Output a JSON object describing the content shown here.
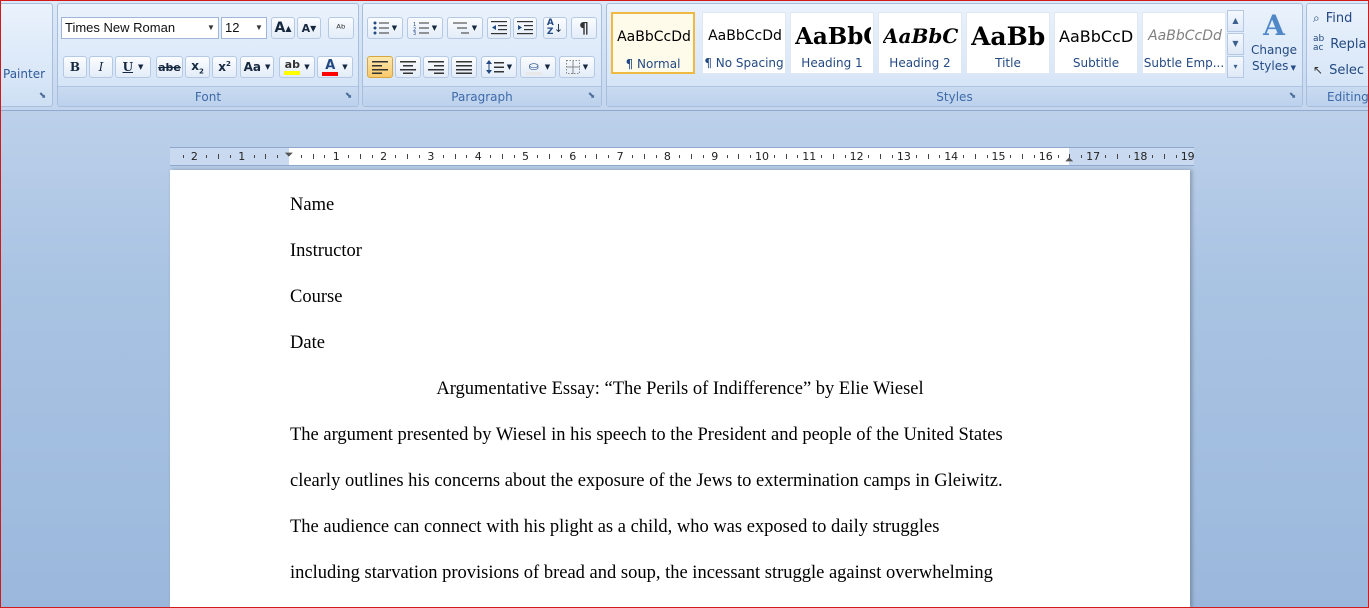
{
  "clipboard": {
    "format_painter_label": "Painter"
  },
  "font_group": {
    "label": "Font",
    "font_name": "Times New Roman",
    "font_size": "12",
    "grow_font": "A",
    "shrink_font": "A",
    "bold": "B",
    "italic": "I",
    "underline": "U",
    "strikethrough": "abe",
    "subscript": "x",
    "superscript": "x",
    "change_case": "Aa",
    "highlight_color": "#ffff00",
    "font_color": "#ff0000"
  },
  "paragraph_group": {
    "label": "Paragraph",
    "show_marks": "¶"
  },
  "styles_group": {
    "label": "Styles",
    "items": [
      {
        "sample": "AaBbCcDd",
        "name": "¶ Normal",
        "selected": true
      },
      {
        "sample": "AaBbCcDd",
        "name": "¶ No Spacing"
      },
      {
        "sample": "AaBbC(",
        "name": "Heading 1"
      },
      {
        "sample": "AaBbCc",
        "name": "Heading 2"
      },
      {
        "sample": "AaBb(",
        "name": "Title"
      },
      {
        "sample": "AaBbCcD",
        "name": "Subtitle"
      },
      {
        "sample": "AaBbCcDd",
        "name": "Subtle Emp..."
      }
    ],
    "change_styles": [
      "Change",
      "Styles"
    ]
  },
  "editing_group": {
    "label": "Editing",
    "find": "Find",
    "replace": "Repla",
    "select": "Selec"
  },
  "ruler": {
    "left_numbers": [
      "2",
      "1"
    ],
    "right_numbers": [
      "1",
      "2",
      "3",
      "4",
      "5",
      "6",
      "7",
      "8",
      "9",
      "10",
      "11",
      "12",
      "13",
      "14",
      "15",
      "16",
      "17",
      "18",
      "19"
    ]
  },
  "document": {
    "header_lines": [
      "Name",
      "Instructor",
      "Course",
      "Date"
    ],
    "title": "Argumentative Essay: “The Perils of Indifference” by Elie Wiesel",
    "body_lines": [
      "The argument presented by Wiesel in his speech to the President and people of the United States",
      "clearly outlines his concerns about the exposure of the Jews to extermination camps in Gleiwitz.",
      "The audience can connect with his plight as a child, who was exposed to daily struggles",
      "including starvation provisions of bread and soup, the incessant struggle against overwhelming"
    ]
  }
}
